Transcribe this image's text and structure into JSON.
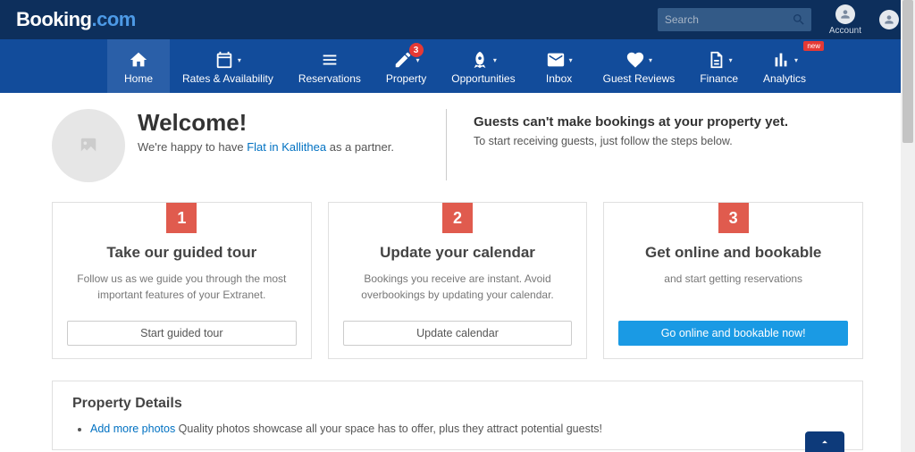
{
  "topbar": {
    "brand_main": "Booking",
    "brand_suffix": ".com",
    "search_placeholder": "Search",
    "account_label": "Account"
  },
  "nav": {
    "items": [
      {
        "label": "Home",
        "active": true
      },
      {
        "label": "Rates & Availability"
      },
      {
        "label": "Reservations"
      },
      {
        "label": "Property",
        "notif": "3"
      },
      {
        "label": "Opportunities"
      },
      {
        "label": "Inbox"
      },
      {
        "label": "Guest Reviews"
      },
      {
        "label": "Finance"
      },
      {
        "label": "Analytics",
        "newBadge": "new"
      }
    ]
  },
  "welcome": {
    "title": "Welcome!",
    "sub_prefix": "We're happy to have ",
    "sub_link": "Flat in Kallithea",
    "sub_suffix": " as a partner.",
    "right_title": "Guests can't make bookings at your property yet.",
    "right_sub": "To start receiving guests, just follow the steps below."
  },
  "steps": [
    {
      "num": "1",
      "title": "Take our guided tour",
      "desc": "Follow us as we guide you through the most important features of your Extranet.",
      "btn": "Start guided tour",
      "primary": false
    },
    {
      "num": "2",
      "title": "Update your calendar",
      "desc": "Bookings you receive are instant. Avoid overbookings by updating your calendar.",
      "btn": "Update calendar",
      "primary": false
    },
    {
      "num": "3",
      "title": "Get online and bookable",
      "desc": "and start getting reservations",
      "btn": "Go online and bookable now!",
      "primary": true
    }
  ],
  "details": {
    "title": "Property Details",
    "item_link": "Add more photos",
    "item_text": " Quality photos showcase all your space has to offer, plus they attract potential guests!"
  }
}
